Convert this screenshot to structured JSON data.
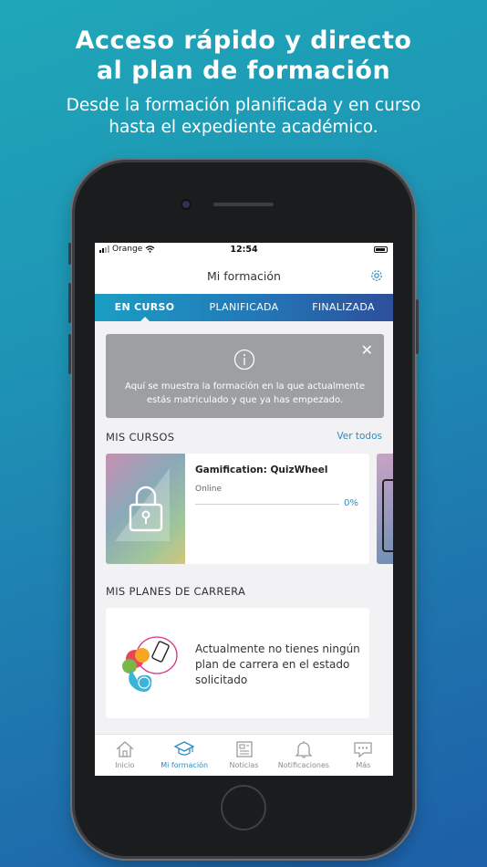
{
  "hero": {
    "title_line1": "Acceso rápido y directo",
    "title_line2": "al plan de formación",
    "subtitle_line1": "Desde la formación planificada y en curso",
    "subtitle_line2": "hasta el expediente académico."
  },
  "status_bar": {
    "carrier": "Orange",
    "time": "12:54"
  },
  "header": {
    "title": "Mi formación",
    "settings_icon": "gear-icon"
  },
  "tabs": [
    {
      "label": "EN CURSO",
      "active": true
    },
    {
      "label": "PLANIFICADA",
      "active": false
    },
    {
      "label": "FINALIZADA",
      "active": false
    }
  ],
  "info_box": {
    "text_line1": "Aquí se muestra la formación en la que actualmente",
    "text_line2": "estás matriculado y que ya has empezado.",
    "close_label": "✕"
  },
  "courses_section": {
    "title": "MIS CURSOS",
    "see_all": "Ver todos",
    "items": [
      {
        "name": "Gamification: QuizWheel",
        "type": "Online",
        "progress": "0%",
        "progress_value": 0
      }
    ]
  },
  "career_section": {
    "title": "MIS PLANES DE CARRERA",
    "empty_line1": "Actualmente no tienes ningún",
    "empty_line2": "plan de carrera en el estado",
    "empty_line3": "solicitado"
  },
  "tabbar": [
    {
      "label": "Inicio",
      "icon": "home-icon",
      "active": false
    },
    {
      "label": "Mi formación",
      "icon": "graduation-cap-icon",
      "active": true
    },
    {
      "label": "Noticias",
      "icon": "newspaper-icon",
      "active": false
    },
    {
      "label": "Notificaciones",
      "icon": "bell-icon",
      "active": false
    },
    {
      "label": "Más",
      "icon": "chat-more-icon",
      "active": false
    }
  ],
  "colors": {
    "accent": "#2b8cc4",
    "tab_gradient_start": "#1a9ec4",
    "tab_gradient_end": "#2e4f9a",
    "info_bg": "#9d9fa2"
  }
}
